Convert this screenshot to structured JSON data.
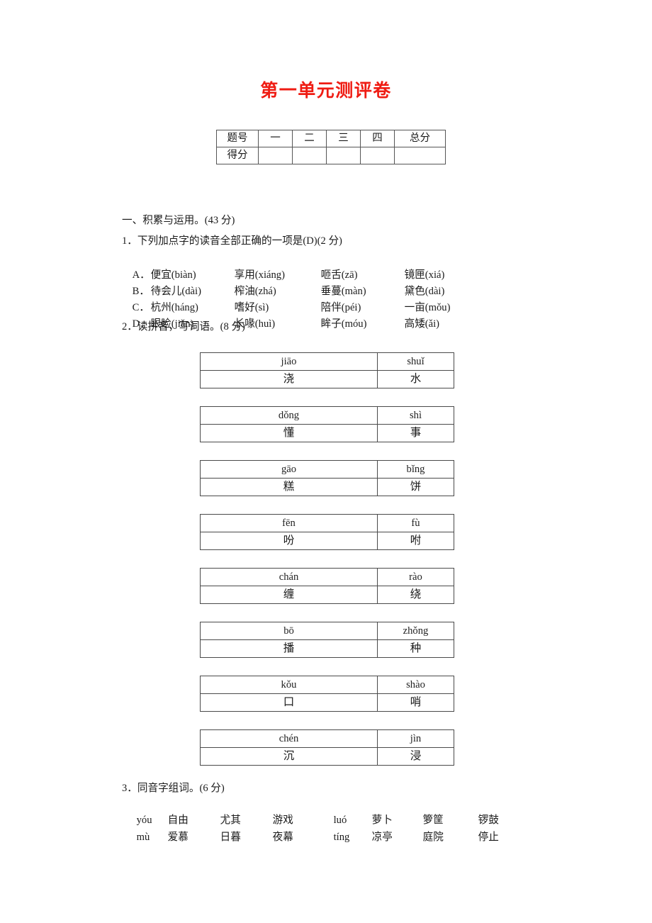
{
  "document": {
    "title": "第一单元测评卷",
    "title_color": "#ef1c13"
  },
  "score_table": {
    "row_labels": [
      "题号",
      "得分"
    ],
    "columns": [
      "一",
      "二",
      "三",
      "四",
      "总分"
    ],
    "scores": [
      "",
      "",
      "",
      "",
      ""
    ]
  },
  "section_one": {
    "heading": "一、积累与运用。(43 分)",
    "q1": {
      "stem": "1．下列加点字的读音全部正确的一项是(D)(2 分)",
      "options": [
        {
          "letter": "A．",
          "items": [
            "便宜(biàn)",
            "享用(xiáng)",
            "咂舌(zā)",
            "镜匣(xiá)"
          ]
        },
        {
          "letter": "B．",
          "items": [
            "待会儿(dài)",
            "榨油(zhá)",
            "垂蔓(màn)",
            "黛色(dài)"
          ]
        },
        {
          "letter": "C．",
          "items": [
            "杭州(háng)",
            "嗜好(sì)",
            "陪伴(péi)",
            "一亩(mǒu)"
          ]
        },
        {
          "letter": "D．",
          "items": [
            "眼睑(jiǎn)",
            "长喙(huì)",
            "眸子(móu)",
            "高矮(ǎi)"
          ]
        }
      ]
    },
    "q2": {
      "stem": "2．读拼音，写词语。(8 分)",
      "word_tables": [
        {
          "pinyin_1": "jiāo",
          "pinyin_2": "shuǐ",
          "hanzi_1": "浇",
          "hanzi_2": "水"
        },
        {
          "pinyin_1": "dǒng",
          "pinyin_2": "shì",
          "hanzi_1": "懂",
          "hanzi_2": "事"
        },
        {
          "pinyin_1": "gāo",
          "pinyin_2": "bǐng",
          "hanzi_1": "糕",
          "hanzi_2": "饼"
        },
        {
          "pinyin_1": "fēn",
          "pinyin_2": "fù",
          "hanzi_1": "吩",
          "hanzi_2": "咐"
        },
        {
          "pinyin_1": "chán",
          "pinyin_2": "rào",
          "hanzi_1": "缠",
          "hanzi_2": "绕"
        },
        {
          "pinyin_1": "bō",
          "pinyin_2": "zhǒng",
          "hanzi_1": "播",
          "hanzi_2": "种"
        },
        {
          "pinyin_1": "kǒu",
          "pinyin_2": "shào",
          "hanzi_1": "口",
          "hanzi_2": "哨"
        },
        {
          "pinyin_1": "chén",
          "pinyin_2": "jìn",
          "hanzi_1": "沉",
          "hanzi_2": "浸"
        }
      ]
    },
    "q3": {
      "stem": "3．同音字组词。(6 分)",
      "line_1": {
        "pinyin_left": "yóu",
        "words_left": [
          "自由",
          "尤其",
          "游戏"
        ],
        "pinyin_right": "luó",
        "words_right": [
          "萝卜",
          "箩筐",
          "锣鼓"
        ]
      },
      "line_2": {
        "pinyin_left": "mù",
        "words_left": [
          "爱慕",
          "日暮",
          "夜幕"
        ],
        "pinyin_right": "tíng",
        "words_right": [
          "凉亭",
          "庭院",
          "停止"
        ]
      }
    }
  }
}
